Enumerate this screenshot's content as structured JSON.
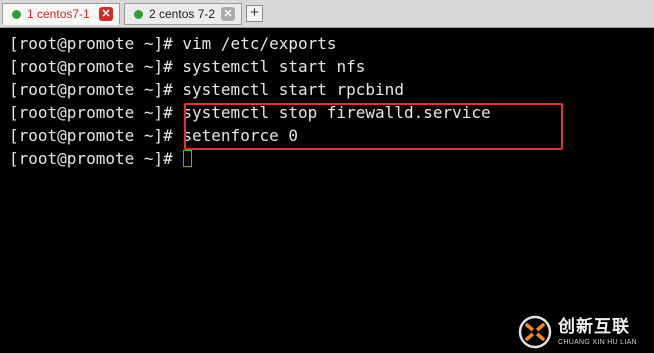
{
  "tabs": [
    {
      "label": "1 centos7-1",
      "active": true,
      "status_color": "#2e9e3a",
      "close_icon": "close-icon"
    },
    {
      "label": "2 centos 7-2",
      "active": false,
      "status_color": "#2e9e3a",
      "close_icon": "close-icon"
    }
  ],
  "add_tab_label": "+",
  "terminal": {
    "lines": [
      "[root@promote ~]# vim /etc/exports",
      "[root@promote ~]# systemctl start nfs",
      "[root@promote ~]# systemctl start rpcbind",
      "[root@promote ~]# systemctl stop firewalld.service",
      "[root@promote ~]# setenforce 0",
      "[root@promote ~]# "
    ],
    "cursor_color": "#1fd12a",
    "text_color": "#e6e6e6",
    "background": "#000000"
  },
  "annotation": {
    "color": "#e5322d"
  },
  "watermark": {
    "cn": "创新互联",
    "en": "CHUANG XIN HU LIAN"
  }
}
